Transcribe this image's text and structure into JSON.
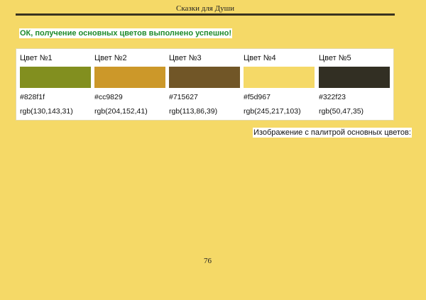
{
  "header": {
    "title": "Сказки для Души"
  },
  "status_message": "ОК, получение основных цветов выполнено успешно!",
  "palette": {
    "colors": [
      {
        "name": "Цвет №1",
        "hex": "#828f1f",
        "rgb": "rgb(130,143,31)"
      },
      {
        "name": "Цвет №2",
        "hex": "#cc9829",
        "rgb": "rgb(204,152,41)"
      },
      {
        "name": "Цвет №3",
        "hex": "#715627",
        "rgb": "rgb(113,86,39)"
      },
      {
        "name": "Цвет №4",
        "hex": "#f5d967",
        "rgb": "rgb(245,217,103)"
      },
      {
        "name": "Цвет №5",
        "hex": "#322f23",
        "rgb": "rgb(50,47,35)"
      }
    ]
  },
  "caption": "Изображение с палитрой основных цветов:",
  "footer": {
    "page_number": "76"
  }
}
